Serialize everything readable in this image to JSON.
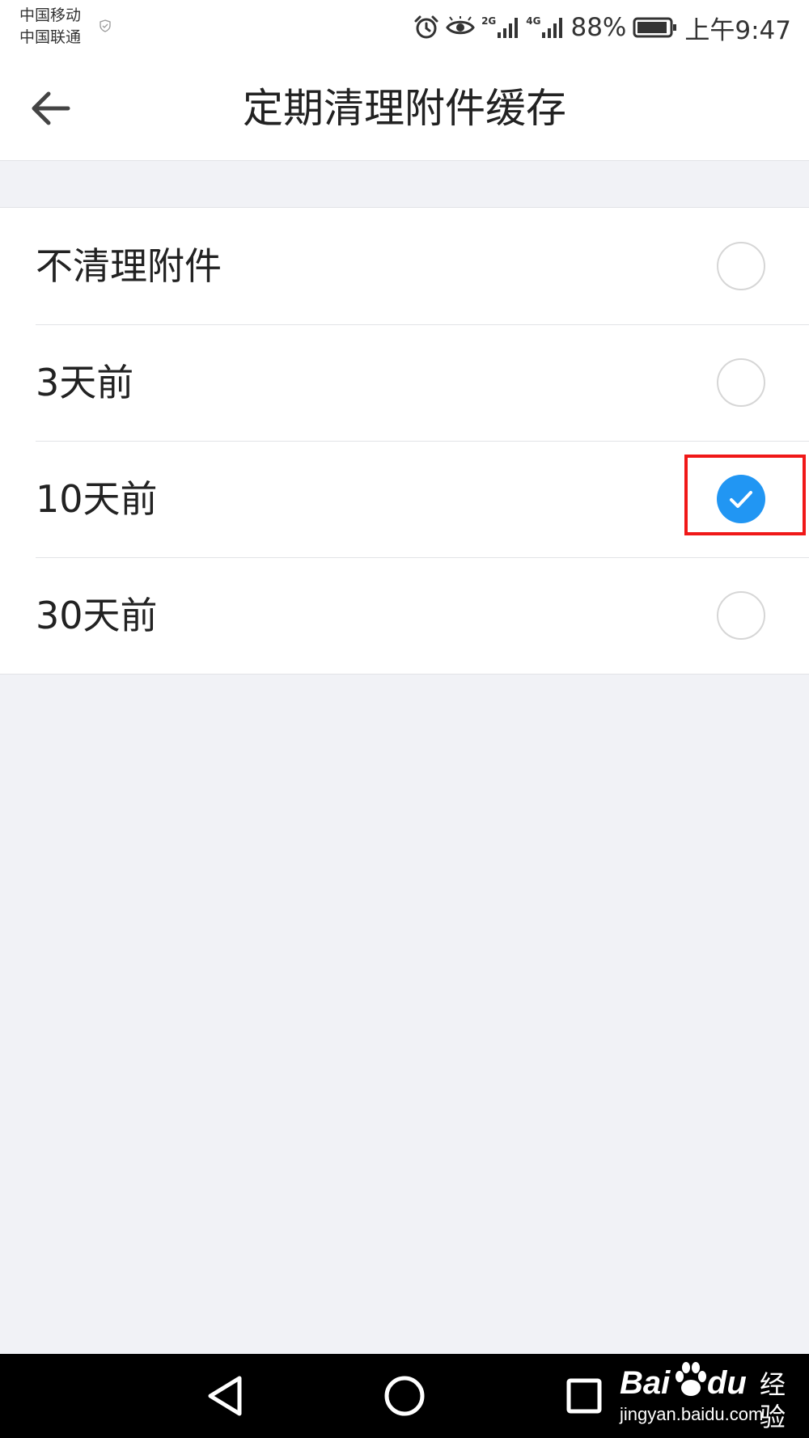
{
  "status_bar": {
    "carrier_1": "中国移动",
    "carrier_2": "中国联通",
    "network_1": "2G",
    "network_2": "4G",
    "battery": "88%",
    "time": "上午9:47",
    "icons": [
      "alarm-icon",
      "eye-icon",
      "signal-icon",
      "signal-icon",
      "battery-icon"
    ]
  },
  "header": {
    "title": "定期清理附件缓存",
    "back_icon": "arrow-left-icon"
  },
  "options": [
    {
      "label": "不清理附件",
      "selected": false
    },
    {
      "label": "3天前",
      "selected": false
    },
    {
      "label": "10天前",
      "selected": true
    },
    {
      "label": "30天前",
      "selected": false
    }
  ],
  "colors": {
    "accent": "#2196f3",
    "highlight": "#f01818",
    "background": "#f1f2f6",
    "nav_bar": "#000000"
  },
  "watermark": {
    "bai": "Bai",
    "du": "du",
    "sub": "经验",
    "url": "jingyan.baidu.com"
  }
}
